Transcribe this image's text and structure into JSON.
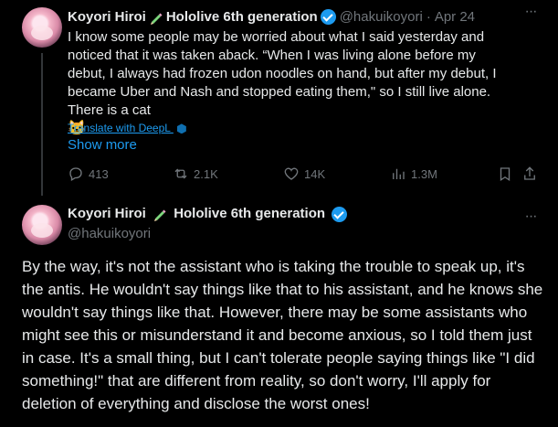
{
  "tweet1": {
    "name": "Koyori Hiroi",
    "name_suffix": "Hololive 6th generation",
    "handle": "@hakuikoyori",
    "date": "Apr 24",
    "text": "I know some people may be worried about what I said yesterday and noticed that it was taken aback. “When I was living alone before my debut, I always had frozen udon noodles on hand, but after my debut, I became Uber and Nash and stopped eating them,\" so I still live alone. There is a cat",
    "emoji": "🐱",
    "translate_label": "Translate with DeepL",
    "show_more": "Show more",
    "replies": "413",
    "reposts": "2.1K",
    "likes": "14K",
    "views": "1.3M"
  },
  "tweet2": {
    "name": "Koyori Hiroi",
    "name_suffix": "Hololive 6th generation",
    "handle": "@hakuikoyori",
    "text": "By the way, it's not the assistant who is taking the trouble to speak up, it's the antis. He wouldn't say things like that to his assistant, and he knows she wouldn't say things like that. However, there may be some assistants who might see this or misunderstand it and become anxious, so I told them just in case. It's a small thing, but I can't tolerate people saying things like \"I did something!\" that are different from reality, so don't worry, I'll apply for deletion of everything and disclose the worst ones!"
  },
  "colors": {
    "background": "#000000",
    "text": "#e7e9ea",
    "muted": "#71767b",
    "accent": "#1d9bf0",
    "divider": "#2f3336"
  },
  "icons": [
    "more-icon",
    "verified-icon",
    "pencil-emoji-icon",
    "reply-icon",
    "repost-icon",
    "like-icon",
    "views-icon",
    "bookmark-icon",
    "share-icon",
    "deepl-icon"
  ]
}
